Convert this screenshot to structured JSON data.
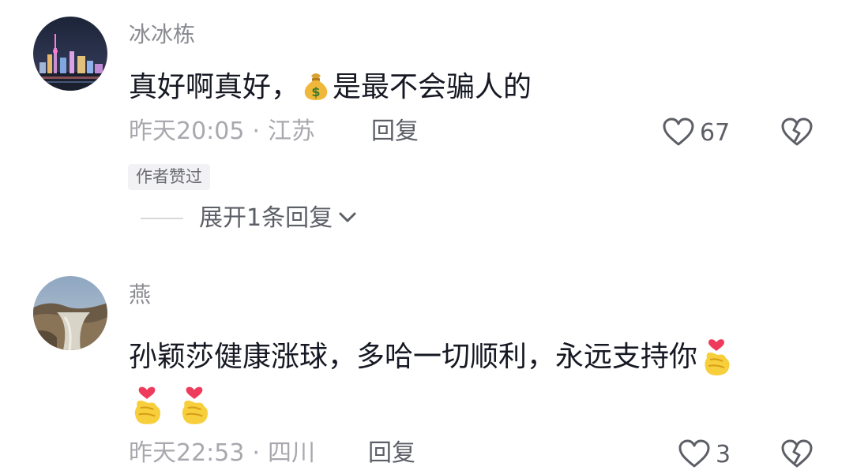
{
  "comments": [
    {
      "username": "冰冰栋",
      "text_before": "真好啊真好，",
      "text_emoji": "money-bag",
      "text_after": "是最不会骗人的",
      "time": "昨天20:05",
      "separator": "·",
      "location": "江苏",
      "reply_label": "回复",
      "likes": "67",
      "badge": "作者赞过",
      "expand_label": "展开1条回复"
    },
    {
      "username": "燕",
      "text": "孙颖莎健康涨球，多哈一切顺利，永远支持你",
      "trailing_emoji": "finger-heart",
      "extra_emojis": [
        "finger-heart",
        "finger-heart"
      ],
      "time": "昨天22:53",
      "separator": "·",
      "location": "四川",
      "reply_label": "回复",
      "likes": "3"
    }
  ],
  "colors": {
    "username": "#8a8b91",
    "text": "#161823",
    "meta": "#a8a9ae",
    "action": "#5d5f67",
    "badge_bg": "#f2f2f4"
  }
}
